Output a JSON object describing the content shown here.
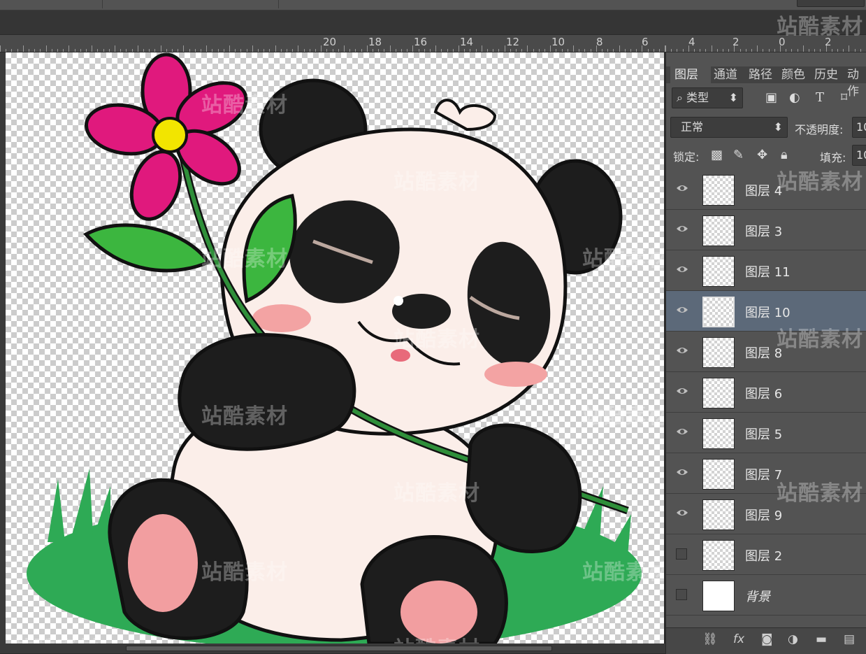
{
  "watermark": "站酷素材",
  "ruler": {
    "labels": [
      "20",
      "18",
      "16",
      "14",
      "12",
      "10",
      "8",
      "6",
      "4",
      "2",
      "0",
      "2"
    ]
  },
  "panel": {
    "tabs": [
      "图层",
      "通道",
      "路径",
      "颜色",
      "历史",
      "动作"
    ],
    "filter_label": "类型",
    "blend_mode": "正常",
    "opacity_label": "不透明度:",
    "opacity_value": "10",
    "lock_label": "锁定:",
    "fill_label": "填充:",
    "fill_value": "10"
  },
  "layers": [
    {
      "name": "图层 4",
      "visible": true,
      "selected": false
    },
    {
      "name": "图层 3",
      "visible": true,
      "selected": false
    },
    {
      "name": "图层 11",
      "visible": true,
      "selected": false
    },
    {
      "name": "图层 10",
      "visible": true,
      "selected": true
    },
    {
      "name": "图层 8",
      "visible": true,
      "selected": false
    },
    {
      "name": "图层 6",
      "visible": true,
      "selected": false
    },
    {
      "name": "图层 5",
      "visible": true,
      "selected": false
    },
    {
      "name": "图层 7",
      "visible": true,
      "selected": false
    },
    {
      "name": "图层 9",
      "visible": true,
      "selected": false
    },
    {
      "name": "图层 2",
      "visible": false,
      "selected": false
    },
    {
      "name": "背景",
      "visible": false,
      "selected": false
    }
  ],
  "footer_icons": [
    "link-icon",
    "fx-icon",
    "mask-icon",
    "adjustment-icon",
    "folder-icon",
    "new-layer-icon"
  ],
  "colors": {
    "panel_bg": "#535353",
    "selected_row": "#5c6979",
    "panda_black": "#1d1d1d",
    "flower_pink": "#e0197d",
    "grass_green": "#2eaa55"
  }
}
